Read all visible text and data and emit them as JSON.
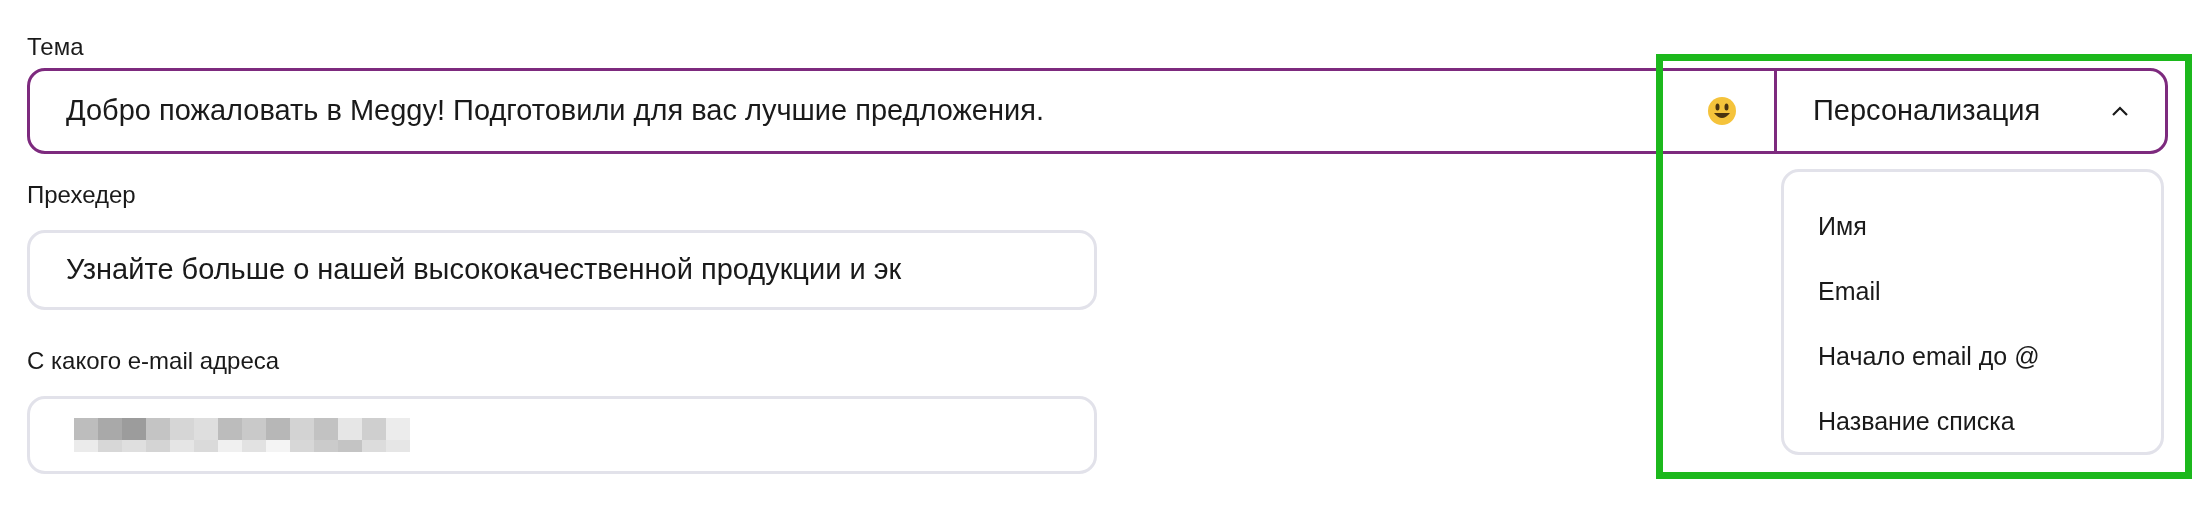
{
  "fields": [
    {
      "label": "Тема",
      "value": "Добро пожаловать в Meggy! Подготовили для вас лучшие предложения.",
      "focused": true,
      "kind": "subject"
    },
    {
      "label": "Прехедер",
      "value": "Узнайте больше о нашей высококачественной продукции и эк",
      "focused": false,
      "kind": "text"
    },
    {
      "label": "С какого e-mail адреса",
      "focused": false,
      "kind": "redacted"
    }
  ],
  "personalization": {
    "label": "Персонализация",
    "expanded": true,
    "items": [
      "Имя",
      "Email",
      "Начало email до @",
      "Название списка"
    ]
  },
  "highlight": {
    "color": "#1cb81c"
  }
}
